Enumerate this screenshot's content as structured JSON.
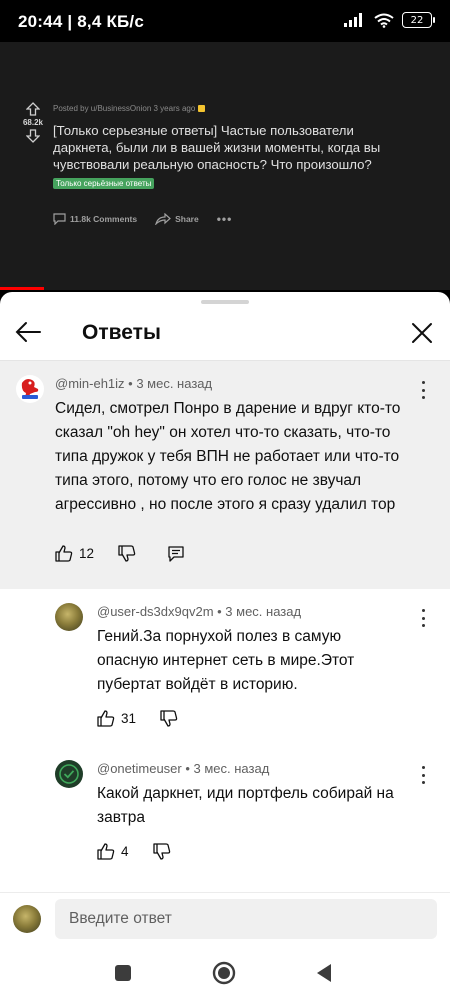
{
  "status": {
    "time": "20:44 | 8,4 КБ/с",
    "battery": "22"
  },
  "post": {
    "meta": "Posted by u/BusinessOnion 3 years ago",
    "votes": "68.2k",
    "title": "[Только серьезные ответы] Частые пользователи даркнета, были ли в вашей жизни моменты, когда вы чувствовали реальную опасность? Что произошло?",
    "flair": "Только серьёзные ответы",
    "comments": "11.8k Comments",
    "share": "Share"
  },
  "sheet": {
    "title": "Ответы"
  },
  "main_comment": {
    "author": "@min-eh1iz • 3 мес. назад",
    "text": "Сидел, смотрел Понро в дарение и вдруг кто-то сказал \"oh hey\" он хотел что-то сказать, что-то типа дружок у тебя ВПН не работает или что-то типа этого, потому что его голос не звучал агрессивно , но после этого я сразу удалил тор",
    "likes": "12"
  },
  "replies": [
    {
      "author": "@user-ds3dx9qv2m • 3 мес. назад",
      "text": "Гений.За порнухой полез в самую опасную интернет сеть в мире.Этот пубертат войдёт в историю.",
      "likes": "31"
    },
    {
      "author": "@onetimeuser • 3 мес. назад",
      "text": "Какой даркнет, иди портфель собирай на завтра",
      "likes": "4"
    }
  ],
  "input": {
    "placeholder": "Введите ответ"
  },
  "colors": {
    "accent_red": "#ff0000",
    "flair_green": "#46a35e",
    "thread_bg": "#f0f0f0"
  },
  "icons": [
    "signal-icon",
    "wifi-icon",
    "battery-icon",
    "upvote-icon",
    "downvote-icon",
    "comment-icon",
    "share-icon",
    "back-arrow-icon",
    "close-icon",
    "like-icon",
    "dislike-icon",
    "reply-icon",
    "more-icon",
    "nav-recents-icon",
    "nav-home-icon",
    "nav-back-icon"
  ]
}
